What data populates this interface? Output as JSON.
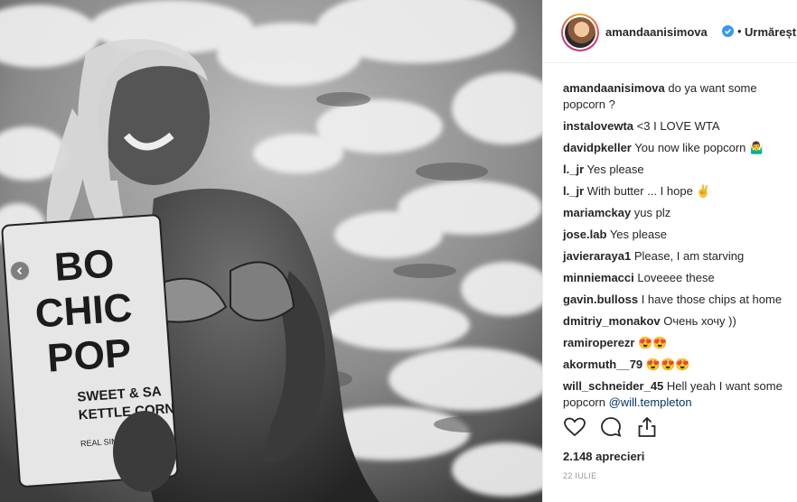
{
  "post": {
    "username": "amandaanisimova",
    "separator": "•",
    "follow_label": "Urmărești",
    "likes": "2.148 aprecieri",
    "date": "22 IULIE"
  },
  "photo": {
    "bag_text": [
      "BO",
      "CHIC",
      "POP",
      "SWEET & SA",
      "KETTLE CORN",
      "REAL SIM"
    ]
  },
  "comments": [
    {
      "user": "amandaanisimova",
      "text": "do ya want some popcorn ?"
    },
    {
      "user": "instalovewta",
      "text": "<3 I LOVE WTA"
    },
    {
      "user": "davidpkeller",
      "text": "You now like popcorn 🤷‍♂️"
    },
    {
      "user": "l._jr",
      "text": "Yes please"
    },
    {
      "user": "l._jr",
      "text": "With butter ... I hope ✌️"
    },
    {
      "user": "mariamckay",
      "text": "yus plz"
    },
    {
      "user": "jose.lab",
      "text": "Yes please"
    },
    {
      "user": "javieraraya1",
      "text": "Please, I am starving"
    },
    {
      "user": "minniemacci",
      "text": "Loveeee these"
    },
    {
      "user": "gavin.bulloss",
      "text": "I have those chips at home"
    },
    {
      "user": "dmitriy_monakov",
      "text": "Очень хочу ))"
    },
    {
      "user": "ramiroperezr",
      "text": "😍😍"
    },
    {
      "user": "akormuth__79",
      "text": "😍😍😍"
    },
    {
      "user": "will_schneider_45",
      "text": "Hell yeah I want some popcorn",
      "mention": "@will.templeton"
    }
  ],
  "icons": {
    "verified": "verified-badge-icon",
    "like": "heart-icon",
    "comment": "comment-icon",
    "share": "share-icon",
    "carousel_prev": "chevron-left-icon"
  },
  "colors": {
    "verified": "#3897f0",
    "mention": "#003569",
    "text": "#262626",
    "muted": "#999999"
  }
}
